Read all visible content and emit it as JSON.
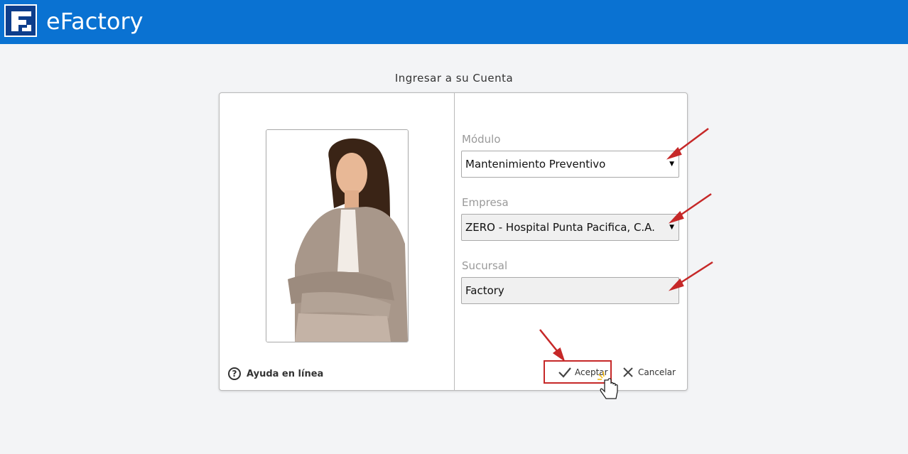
{
  "header": {
    "app_title": "eFactory",
    "logo_icon": "efactory-logo-icon",
    "color": "#0a72d2"
  },
  "login": {
    "title": "Ingresar a su Cuenta",
    "help_label": "Ayuda en línea",
    "modulo": {
      "label": "Módulo",
      "value": "Mantenimiento Preventivo"
    },
    "empresa": {
      "label": "Empresa",
      "value": "ZERO - Hospital Punta Pacifica, C.A."
    },
    "sucursal": {
      "label": "Sucursal",
      "value": "Factory"
    },
    "accept_label": "Aceptar",
    "cancel_label": "Cancelar"
  },
  "annotations": {
    "arrow_color": "#c62828"
  }
}
